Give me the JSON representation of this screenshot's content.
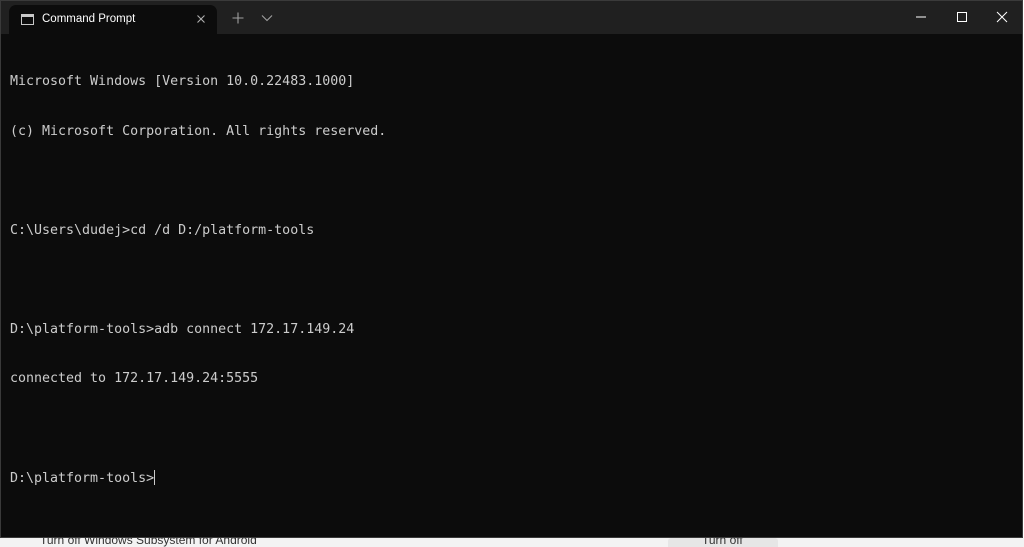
{
  "window": {
    "tab_title": "Command Prompt",
    "tab_icon": "console-icon",
    "new_tab_icon": "plus-icon",
    "dropdown_icon": "chevron-down-icon",
    "controls": [
      "minimize-icon",
      "maximize-icon",
      "close-icon"
    ]
  },
  "console": {
    "lines": [
      "Microsoft Windows [Version 10.0.22483.1000]",
      "(c) Microsoft Corporation. All rights reserved.",
      "",
      "C:\\Users\\dudej>cd /d D:/platform-tools",
      "",
      "D:\\platform-tools>adb connect 172.17.149.24",
      "connected to 172.17.149.24:5555",
      ""
    ],
    "prompt": "D:\\platform-tools>",
    "text_color": "#cccccc",
    "background_color": "#0c0c0c"
  },
  "background_window": {
    "text": "Turn off Windows Subsystem for Android",
    "button_label": "Turn off"
  }
}
